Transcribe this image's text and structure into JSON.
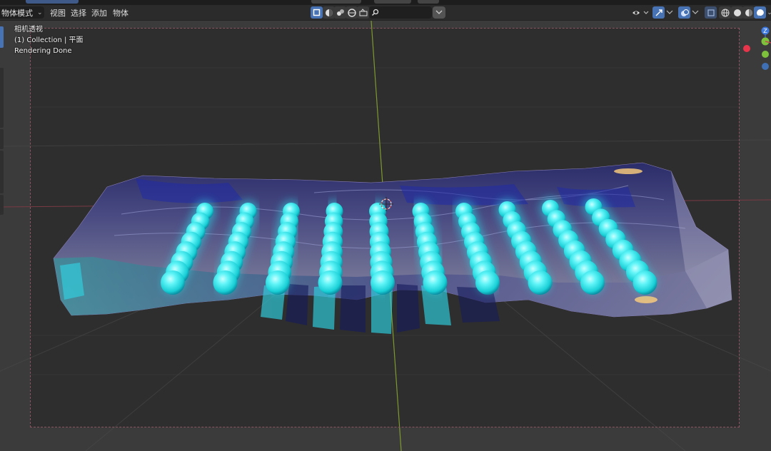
{
  "header": {
    "mode_label": "物体模式",
    "menu": [
      "视图",
      "选择",
      "添加",
      "物体"
    ],
    "search_placeholder": ""
  },
  "viewport": {
    "overlay": {
      "camera_label": "相机透视",
      "collection_label": "(1) Collection | 平面",
      "status_label": "Rendering Done"
    },
    "gizmo": {
      "z_label": "Z"
    }
  },
  "colors": {
    "accent": "#4772b3",
    "sphere_glow": "#29e6ea",
    "x_axis": "#c23c4c",
    "y_axis": "#7ec23c",
    "z_axis": "#3f7ae0"
  },
  "icons": [
    "select-box-icon",
    "transform-icon",
    "cursor-icon",
    "measure-icon",
    "camera-icon",
    "search-icon",
    "visibility-icon",
    "gizmo-icon",
    "overlay-icon",
    "xray-icon",
    "wireframe-icon",
    "solid-icon",
    "material-icon",
    "rendered-icon"
  ]
}
